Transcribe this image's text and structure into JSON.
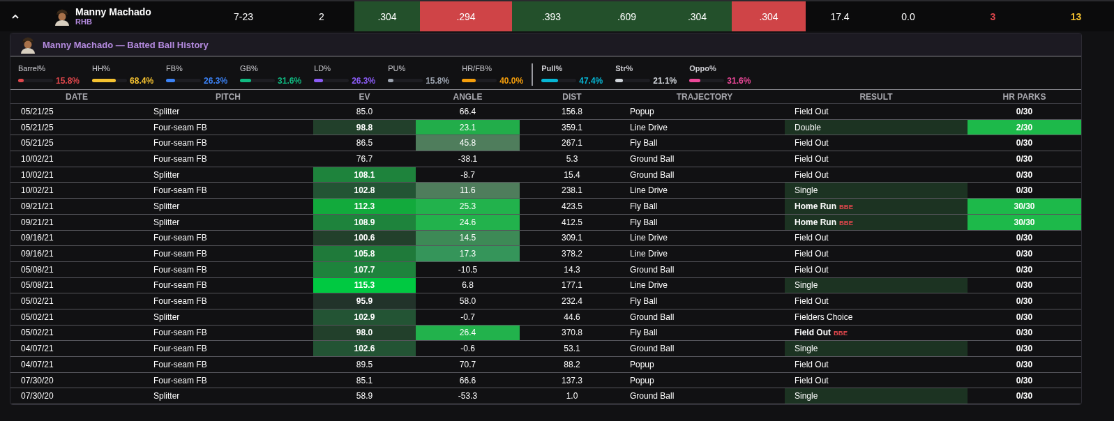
{
  "player_row": {
    "expanded": true,
    "name": "Manny Machado",
    "hand": "RHB",
    "cells": [
      {
        "text": "7-23",
        "kind": "plain"
      },
      {
        "text": "2",
        "kind": "plain"
      },
      {
        "text": ".304",
        "kind": "fill",
        "color": "#23502b"
      },
      {
        "text": ".294",
        "kind": "fill",
        "color": "#cf4447"
      },
      {
        "text": ".393",
        "kind": "fill",
        "color": "#23502b"
      },
      {
        "text": ".609",
        "kind": "fill",
        "color": "#23502b"
      },
      {
        "text": ".304",
        "kind": "fill",
        "color": "#23502b"
      },
      {
        "text": ".304",
        "kind": "fill",
        "color": "#cf4447"
      },
      {
        "text": "17.4",
        "kind": "plain"
      },
      {
        "text": "0.0",
        "kind": "plain"
      },
      {
        "text": "3",
        "kind": "ink",
        "color": "#e0474c"
      },
      {
        "text": "13",
        "kind": "ink",
        "color": "#f5c230"
      }
    ]
  },
  "history": {
    "title": "Manny Machado — Batted Ball History",
    "stat_groups": [
      [
        {
          "label": "Barrel%",
          "value": "15.8%",
          "color": "#e0474c",
          "level": 0.158
        },
        {
          "label": "HH%",
          "value": "68.4%",
          "color": "#f5c230",
          "level": 0.684
        },
        {
          "label": "FB%",
          "value": "26.3%",
          "color": "#3b82f6",
          "level": 0.263
        },
        {
          "label": "GB%",
          "value": "31.6%",
          "color": "#10b981",
          "level": 0.316
        },
        {
          "label": "LD%",
          "value": "26.3%",
          "color": "#8b5cf6",
          "level": 0.263
        },
        {
          "label": "PU%",
          "value": "15.8%",
          "color": "#9ca3af",
          "level": 0.158
        },
        {
          "label": "HR/FB%",
          "value": "40.0%",
          "color": "#f59e0b",
          "level": 0.4
        }
      ],
      [
        {
          "label": "Pull%",
          "value": "47.4%",
          "color": "#06b6d4",
          "level": 0.474
        },
        {
          "label": "Str%",
          "value": "21.1%",
          "color": "#d1d5db",
          "level": 0.211
        },
        {
          "label": "Oppo%",
          "value": "31.6%",
          "color": "#ec4899",
          "level": 0.316
        }
      ]
    ],
    "columns": [
      "DATE",
      "PITCH",
      "EV",
      "ANGLE",
      "DIST",
      "TRAJECTORY",
      "RESULT",
      "HR PARKS"
    ],
    "rows": [
      {
        "date": "05/21/25",
        "pitch": "Splitter",
        "ev": {
          "text": "85.0"
        },
        "angle": {
          "text": "66.4"
        },
        "dist": "156.8",
        "trajectory": "Popup",
        "result": {
          "text": "Field Out"
        },
        "hr_parks": {
          "text": "0/30"
        }
      },
      {
        "date": "05/21/25",
        "pitch": "Four-seam FB",
        "ev": {
          "text": "98.8",
          "color": "#22402b"
        },
        "angle": {
          "text": "23.1",
          "color": "#22ad4a"
        },
        "dist": "359.1",
        "trajectory": "Line Drive",
        "result": {
          "text": "Double",
          "color": "#1c3322"
        },
        "hr_parks": {
          "text": "2/30",
          "color": "#1db94a"
        }
      },
      {
        "date": "05/21/25",
        "pitch": "Four-seam FB",
        "ev": {
          "text": "86.5"
        },
        "angle": {
          "text": "45.8",
          "color": "#4f7d5c"
        },
        "dist": "267.1",
        "trajectory": "Fly Ball",
        "result": {
          "text": "Field Out"
        },
        "hr_parks": {
          "text": "0/30"
        }
      },
      {
        "date": "10/02/21",
        "pitch": "Four-seam FB",
        "ev": {
          "text": "76.7"
        },
        "angle": {
          "text": "-38.1"
        },
        "dist": "5.3",
        "trajectory": "Ground Ball",
        "result": {
          "text": "Field Out"
        },
        "hr_parks": {
          "text": "0/30"
        }
      },
      {
        "date": "10/02/21",
        "pitch": "Splitter",
        "ev": {
          "text": "108.1",
          "color": "#1e833c"
        },
        "angle": {
          "text": "-8.7"
        },
        "dist": "15.4",
        "trajectory": "Ground Ball",
        "result": {
          "text": "Field Out"
        },
        "hr_parks": {
          "text": "0/30"
        }
      },
      {
        "date": "10/02/21",
        "pitch": "Four-seam FB",
        "ev": {
          "text": "102.8",
          "color": "#235434"
        },
        "angle": {
          "text": "11.6",
          "color": "#4f7d5c"
        },
        "dist": "238.1",
        "trajectory": "Line Drive",
        "result": {
          "text": "Single",
          "color": "#1c3322"
        },
        "hr_parks": {
          "text": "0/30"
        }
      },
      {
        "date": "09/21/21",
        "pitch": "Splitter",
        "ev": {
          "text": "112.3",
          "color": "#12aa3c"
        },
        "angle": {
          "text": "25.3",
          "color": "#22b24c"
        },
        "dist": "423.5",
        "trajectory": "Fly Ball",
        "result": {
          "text": "Home Run",
          "tag": "BBE",
          "color": "#1c3322"
        },
        "hr_parks": {
          "text": "30/30",
          "color": "#1db94a"
        }
      },
      {
        "date": "09/21/21",
        "pitch": "Splitter",
        "ev": {
          "text": "108.9",
          "color": "#1e833c"
        },
        "angle": {
          "text": "24.6",
          "color": "#22b24c"
        },
        "dist": "412.5",
        "trajectory": "Fly Ball",
        "result": {
          "text": "Home Run",
          "tag": "BBE",
          "color": "#1c3322"
        },
        "hr_parks": {
          "text": "30/30",
          "color": "#1db94a"
        }
      },
      {
        "date": "09/16/21",
        "pitch": "Four-seam FB",
        "ev": {
          "text": "100.6",
          "color": "#22402b"
        },
        "angle": {
          "text": "14.5",
          "color": "#3d8a56"
        },
        "dist": "309.1",
        "trajectory": "Line Drive",
        "result": {
          "text": "Field Out"
        },
        "hr_parks": {
          "text": "0/30"
        }
      },
      {
        "date": "09/16/21",
        "pitch": "Four-seam FB",
        "ev": {
          "text": "105.8",
          "color": "#1f7a3a"
        },
        "angle": {
          "text": "17.3",
          "color": "#35955a"
        },
        "dist": "378.2",
        "trajectory": "Line Drive",
        "result": {
          "text": "Field Out"
        },
        "hr_parks": {
          "text": "0/30"
        }
      },
      {
        "date": "05/08/21",
        "pitch": "Four-seam FB",
        "ev": {
          "text": "107.7",
          "color": "#1e833c"
        },
        "angle": {
          "text": "-10.5"
        },
        "dist": "14.3",
        "trajectory": "Ground Ball",
        "result": {
          "text": "Field Out"
        },
        "hr_parks": {
          "text": "0/30"
        }
      },
      {
        "date": "05/08/21",
        "pitch": "Four-seam FB",
        "ev": {
          "text": "115.3",
          "color": "#00c941"
        },
        "angle": {
          "text": "6.8"
        },
        "dist": "177.1",
        "trajectory": "Line Drive",
        "result": {
          "text": "Single",
          "color": "#1c3322"
        },
        "hr_parks": {
          "text": "0/30"
        }
      },
      {
        "date": "05/02/21",
        "pitch": "Four-seam FB",
        "ev": {
          "text": "95.9",
          "color": "#22332a"
        },
        "angle": {
          "text": "58.0"
        },
        "dist": "232.4",
        "trajectory": "Fly Ball",
        "result": {
          "text": "Field Out"
        },
        "hr_parks": {
          "text": "0/30"
        }
      },
      {
        "date": "05/02/21",
        "pitch": "Splitter",
        "ev": {
          "text": "102.9",
          "color": "#235434"
        },
        "angle": {
          "text": "-0.7"
        },
        "dist": "44.6",
        "trajectory": "Ground Ball",
        "result": {
          "text": "Fielders Choice"
        },
        "hr_parks": {
          "text": "0/30"
        }
      },
      {
        "date": "05/02/21",
        "pitch": "Four-seam FB",
        "ev": {
          "text": "98.0",
          "color": "#22402b"
        },
        "angle": {
          "text": "26.4",
          "color": "#22b24c"
        },
        "dist": "370.8",
        "trajectory": "Fly Ball",
        "result": {
          "text": "Field Out",
          "tag": "BBE"
        },
        "hr_parks": {
          "text": "0/30"
        }
      },
      {
        "date": "04/07/21",
        "pitch": "Four-seam FB",
        "ev": {
          "text": "102.6",
          "color": "#235434"
        },
        "angle": {
          "text": "-0.6"
        },
        "dist": "53.1",
        "trajectory": "Ground Ball",
        "result": {
          "text": "Single",
          "color": "#1c3322"
        },
        "hr_parks": {
          "text": "0/30"
        }
      },
      {
        "date": "04/07/21",
        "pitch": "Four-seam FB",
        "ev": {
          "text": "89.5"
        },
        "angle": {
          "text": "70.7"
        },
        "dist": "88.2",
        "trajectory": "Popup",
        "result": {
          "text": "Field Out"
        },
        "hr_parks": {
          "text": "0/30"
        }
      },
      {
        "date": "07/30/20",
        "pitch": "Four-seam FB",
        "ev": {
          "text": "85.1"
        },
        "angle": {
          "text": "66.6"
        },
        "dist": "137.3",
        "trajectory": "Popup",
        "result": {
          "text": "Field Out"
        },
        "hr_parks": {
          "text": "0/30"
        }
      },
      {
        "date": "07/30/20",
        "pitch": "Splitter",
        "ev": {
          "text": "58.9"
        },
        "angle": {
          "text": "-53.3"
        },
        "dist": "1.0",
        "trajectory": "Ground Ball",
        "result": {
          "text": "Single",
          "color": "#1c3322"
        },
        "hr_parks": {
          "text": "0/30"
        }
      }
    ]
  }
}
